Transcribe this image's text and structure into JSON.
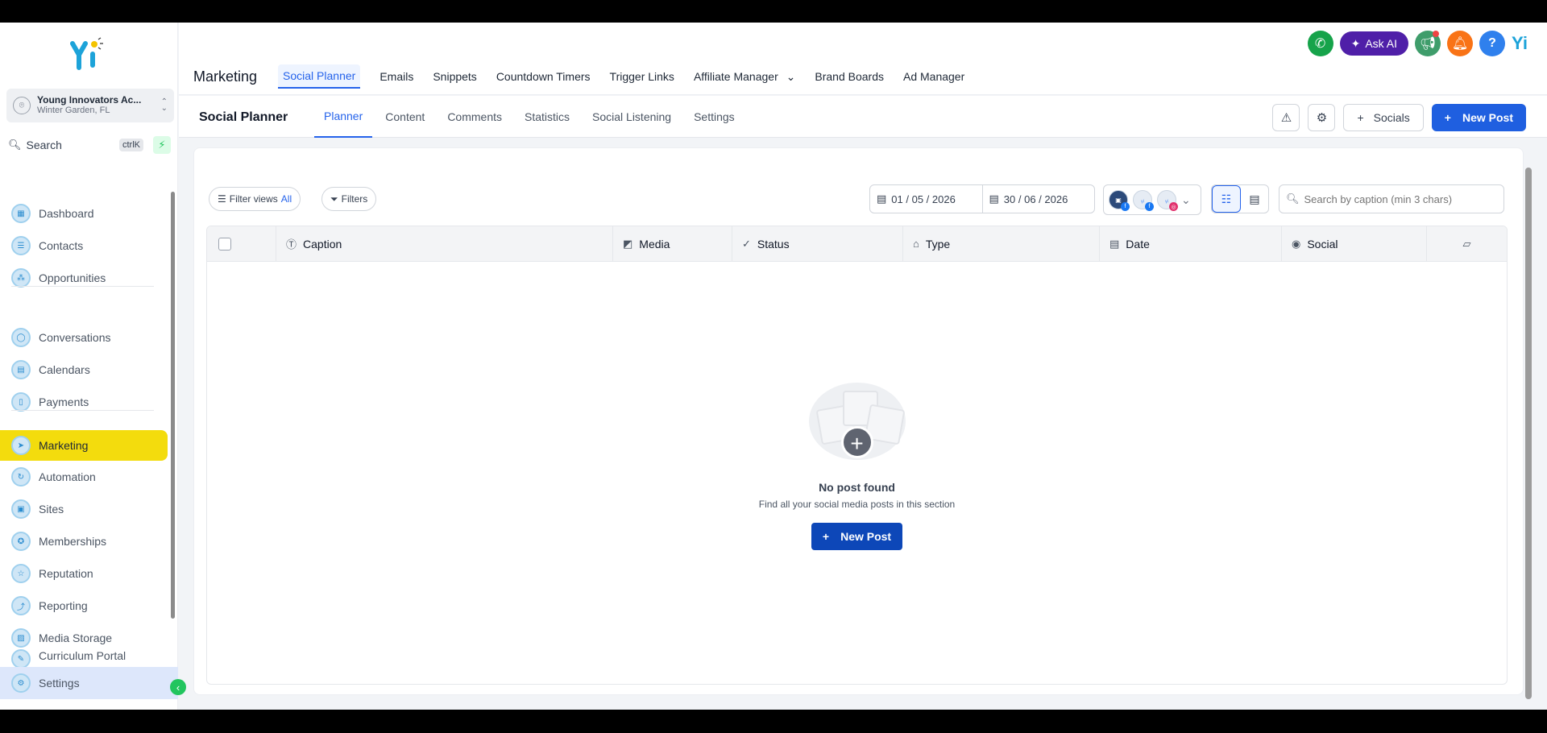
{
  "sidebar": {
    "logo_text": "Yi",
    "account": {
      "name": "Young Innovators Ac...",
      "location": "Winter Garden, FL"
    },
    "search": {
      "label": "Search",
      "shortcut": "ctrlK"
    },
    "items": [
      {
        "label": "Dashboard",
        "icon": "dashboard-icon"
      },
      {
        "label": "Contacts",
        "icon": "contacts-icon"
      },
      {
        "label": "Opportunities",
        "icon": "opportunities-icon"
      },
      {
        "label": "Conversations",
        "icon": "chat-icon"
      },
      {
        "label": "Calendars",
        "icon": "calendar-icon"
      },
      {
        "label": "Payments",
        "icon": "payments-icon"
      },
      {
        "label": "Marketing",
        "icon": "send-icon",
        "active": true
      },
      {
        "label": "Automation",
        "icon": "automation-icon"
      },
      {
        "label": "Sites",
        "icon": "sites-icon"
      },
      {
        "label": "Memberships",
        "icon": "memberships-icon"
      },
      {
        "label": "Reputation",
        "icon": "star-icon"
      },
      {
        "label": "Reporting",
        "icon": "chart-icon"
      },
      {
        "label": "Media Storage",
        "icon": "image-icon"
      },
      {
        "label": "Curriculum Portal",
        "icon": "curriculum-icon"
      }
    ],
    "settings_label": "Settings"
  },
  "header": {
    "title": "Marketing",
    "tabs": [
      "Social Planner",
      "Emails",
      "Snippets",
      "Countdown Timers",
      "Trigger Links",
      "Affiliate Manager",
      "Brand Boards",
      "Ad Manager"
    ],
    "active_tab": "Social Planner",
    "ask_ai": "Ask AI",
    "help": "?",
    "brand_small": "Yi"
  },
  "subheader": {
    "title": "Social Planner",
    "tabs": [
      "Planner",
      "Content",
      "Comments",
      "Statistics",
      "Social Listening",
      "Settings"
    ],
    "active_tab": "Planner",
    "socials_label": "Socials",
    "new_post_label": "New Post"
  },
  "filters": {
    "filter_views_label": "Filter views",
    "filter_views_value": "All",
    "filters_label": "Filters",
    "date_start": "01 / 05 / 2026",
    "date_end": "30 / 06 / 2026",
    "search_placeholder": "Search by caption (min 3 chars)"
  },
  "table": {
    "columns": [
      "Caption",
      "Media",
      "Status",
      "Type",
      "Date",
      "Social"
    ]
  },
  "empty_state": {
    "title": "No post found",
    "subtitle": "Find all your social media posts in this section",
    "button": "New Post"
  },
  "colors": {
    "accent": "#1f5fe0",
    "active_nav": "#f3dc0d",
    "ask_ai": "#4f1fa8"
  }
}
